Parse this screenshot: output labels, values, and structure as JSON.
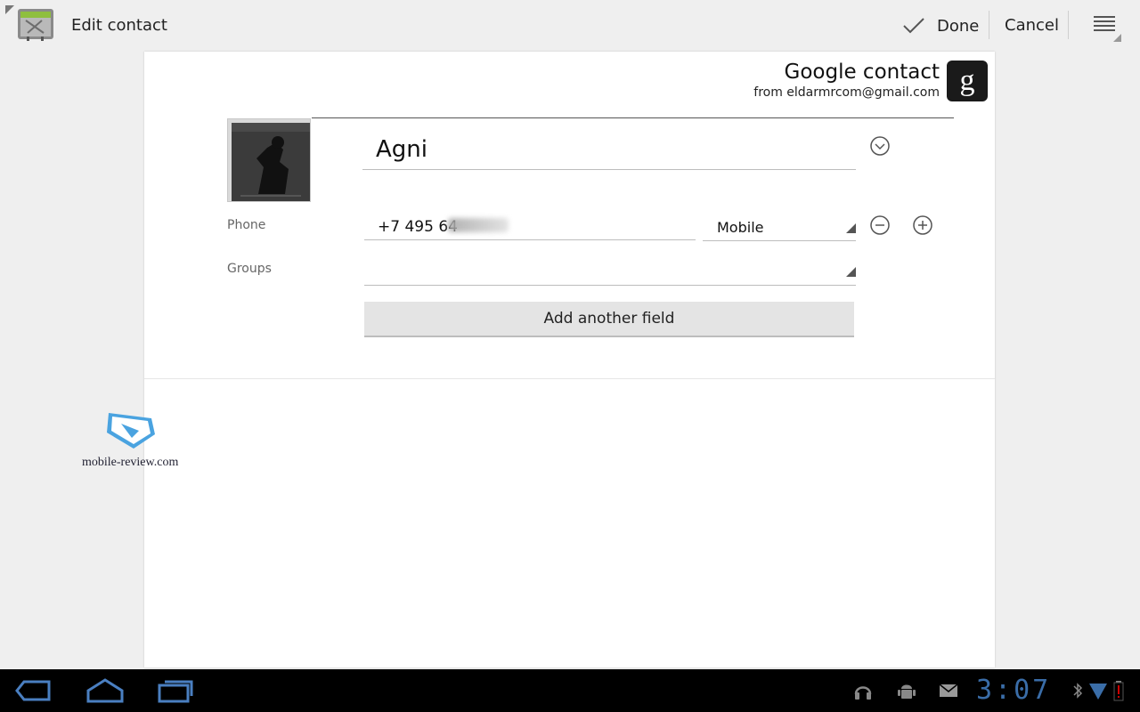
{
  "action_bar": {
    "title": "Edit contact",
    "done_label": "Done",
    "cancel_label": "Cancel",
    "app_icon": "contacts-app-icon",
    "menu_icon": "overflow-menu-icon"
  },
  "account": {
    "type_label": "Google contact",
    "from_label": "from eldarmrcom@gmail.com",
    "icon": "google-g-icon"
  },
  "contact": {
    "name": "Agni",
    "phone_label": "Phone",
    "phone_value": "+7 495 64",
    "phone_type": "Mobile",
    "groups_label": "Groups",
    "groups_value": "",
    "add_field_label": "Add another field"
  },
  "watermark": {
    "text": "mobile-review.com"
  },
  "system_bar": {
    "time": "3:07",
    "nav_icons": [
      "back-icon",
      "home-icon",
      "recent-apps-icon"
    ],
    "status_icons": [
      "headphones-icon",
      "android-debug-icon",
      "email-icon",
      "bluetooth-icon",
      "wifi-icon",
      "battery-low-icon"
    ]
  },
  "colors": {
    "background": "#efefef",
    "card": "#ffffff",
    "system_bar": "#000000",
    "clock": "#3a6da8",
    "battery_alert": "#cc0000"
  }
}
